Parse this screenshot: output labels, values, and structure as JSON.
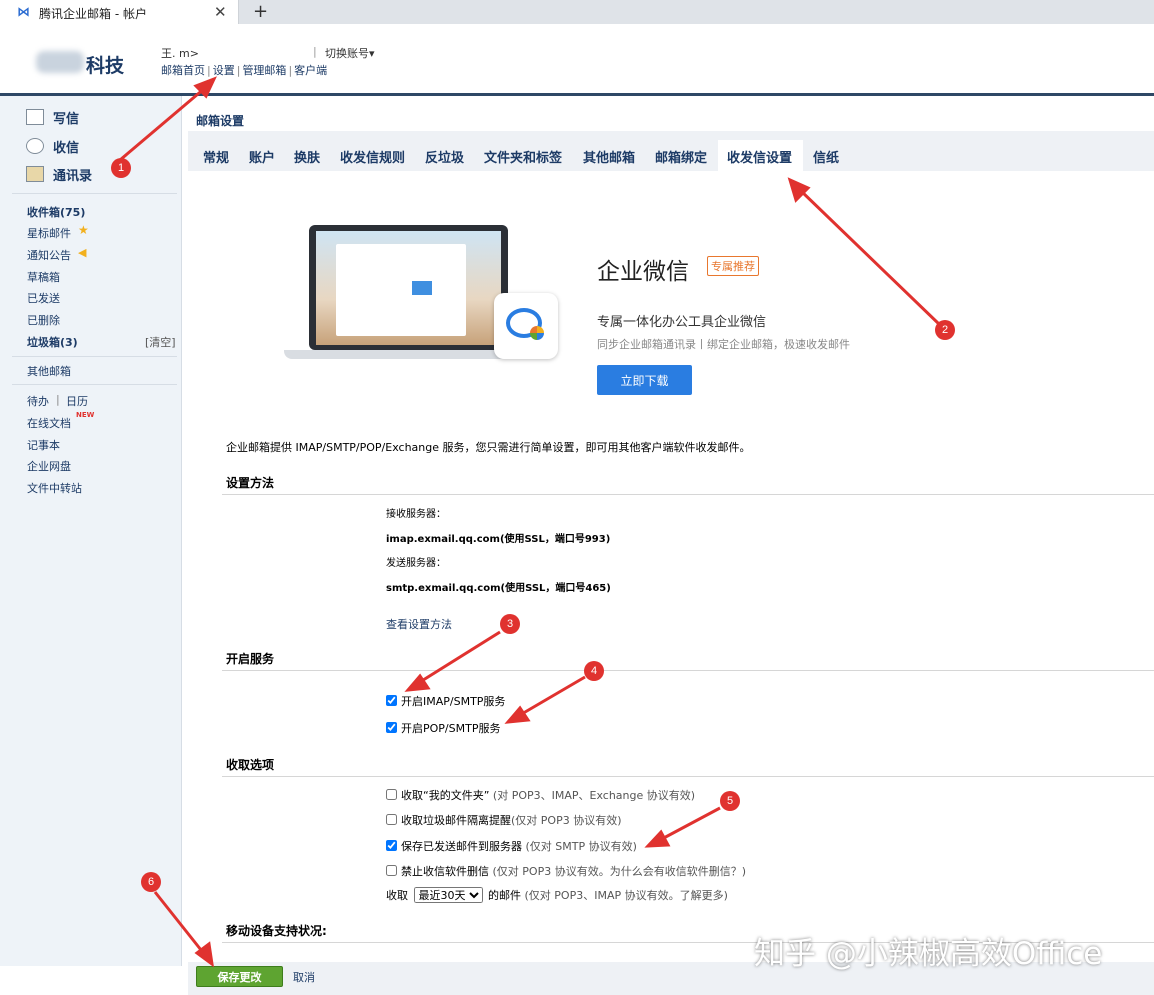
{
  "browser": {
    "tab_title": "腾讯企业邮箱 - 帐户",
    "close_glyph": "✕",
    "new_tab_glyph": "+"
  },
  "header": {
    "logo_text": "科技",
    "account_name": "王.                          m>",
    "account_sep": "|",
    "switch_account": "切换账号▾",
    "nav": [
      "邮箱首页",
      "设置",
      "管理邮箱",
      "客户端"
    ],
    "nav_sep": "|"
  },
  "sidebar": {
    "compose": "写信",
    "inbox": "收信",
    "contacts": "通讯录",
    "folders": [
      "收件箱(75)",
      "星标邮件",
      "通知公告",
      "草稿箱",
      "已发送",
      "已删除",
      "垃圾箱(3)"
    ],
    "clear": "[清空]",
    "other_mail": "其他邮箱",
    "todo": "待办",
    "todo_sep": "|",
    "calendar": "日历",
    "online_docs": "在线文档",
    "new_badge": "NEW",
    "notes": "记事本",
    "netdisk": "企业网盘",
    "transfer": "文件中转站"
  },
  "main": {
    "title": "邮箱设置",
    "tabs": [
      "常规",
      "账户",
      "换肤",
      "收发信规则",
      "反垃圾",
      "文件夹和标签",
      "其他邮箱",
      "邮箱绑定",
      "收发信设置",
      "信纸"
    ],
    "active_tab": "收发信设置"
  },
  "promo": {
    "title": "企业微信",
    "badge": "专属推荐",
    "subtitle": "专属一体化办公工具企业微信",
    "desc": "同步企业邮箱通讯录丨绑定企业邮箱，极速收发邮件",
    "button": "立即下载"
  },
  "intro": "企业邮箱提供 IMAP/SMTP/POP/Exchange 服务，您只需进行简单设置，即可用其他客户端软件收发邮件。",
  "setup": {
    "title": "设置方法",
    "recv_label": "接收服务器：",
    "recv_value": "imap.exmail.qq.com(使用SSL，端口号993)",
    "send_label": "发送服务器：",
    "send_value": "smtp.exmail.qq.com(使用SSL，端口号465)",
    "view_link": "查看设置方法"
  },
  "services": {
    "title": "开启服务",
    "imap": "开启IMAP/SMTP服务",
    "pop": "开启POP/SMTP服务"
  },
  "options": {
    "title": "收取选项",
    "opt1": "收取“我的文件夹”",
    "opt1_note": "(对 POP3、IMAP、Exchange 协议有效)",
    "opt2": "收取垃圾邮件隔离提醒",
    "opt2_note": "(仅对 POP3 协议有效)",
    "opt3": "保存已发送邮件到服务器",
    "opt3_note": "(仅对 SMTP 协议有效)",
    "opt4": "禁止收信软件删信",
    "opt4_note": "(仅对 POP3 协议有效。为什么会有收信软件删信？)",
    "fetch_prefix": "收取",
    "fetch_select": "最近30天",
    "fetch_suffix": "的邮件",
    "fetch_note": "(仅对 POP3、IMAP 协议有效。了解更多)"
  },
  "mobile_title": "移动设备支持状况:",
  "actions": {
    "save": "保存更改",
    "cancel": "取消"
  },
  "watermark": "知乎 @小辣椒高效Office",
  "annotations": [
    "1",
    "2",
    "3",
    "4",
    "5",
    "6"
  ]
}
